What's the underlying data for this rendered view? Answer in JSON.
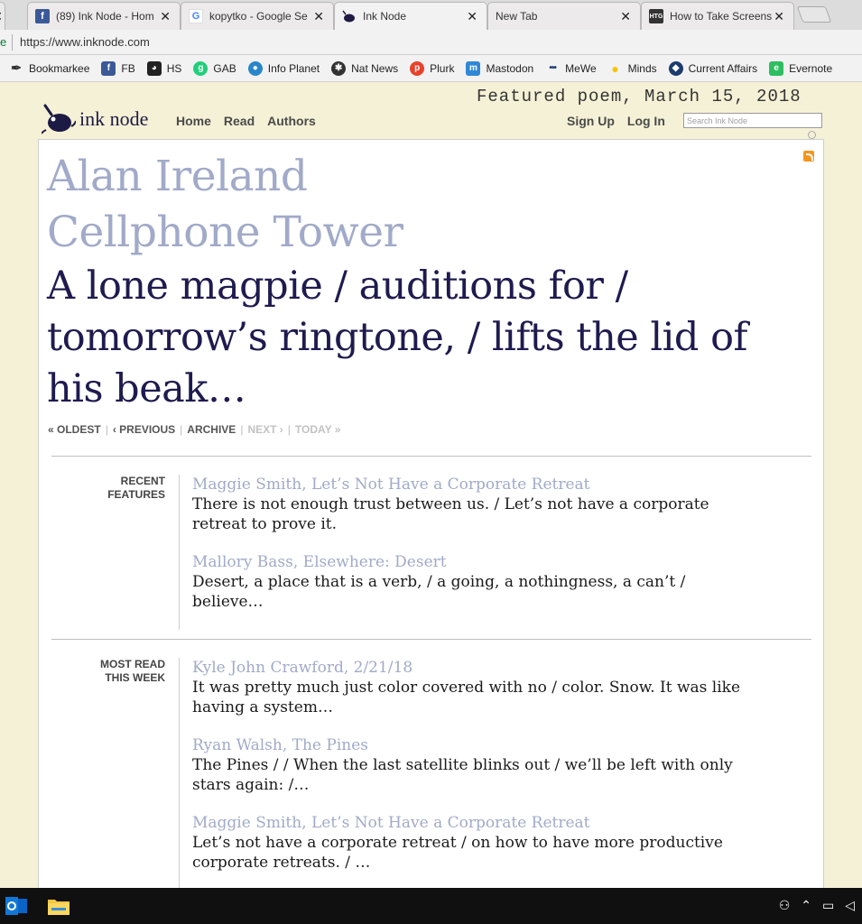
{
  "browser": {
    "tabs": [
      {
        "label": "(89) Ink Node - Hom",
        "icon": "facebook-icon",
        "active": false
      },
      {
        "label": "kopytko - Google Se",
        "icon": "google-icon",
        "active": false
      },
      {
        "label": "Ink Node",
        "icon": "inknode-icon",
        "active": true
      },
      {
        "label": "New Tab",
        "icon": "",
        "active": false
      },
      {
        "label": "How to Take Screens",
        "icon": "htg-icon",
        "active": false
      }
    ],
    "url": "https://www.inknode.com",
    "bookmarks": [
      {
        "label": "Bookmarkee",
        "icon": "bookmarkee-icon"
      },
      {
        "label": "FB",
        "icon": "facebook-icon"
      },
      {
        "label": "HS",
        "icon": "hootsuite-icon"
      },
      {
        "label": "GAB",
        "icon": "gab-icon"
      },
      {
        "label": "Info Planet",
        "icon": "infoplanet-icon"
      },
      {
        "label": "Nat News",
        "icon": "natnews-icon"
      },
      {
        "label": "Plurk",
        "icon": "plurk-icon"
      },
      {
        "label": "Mastodon",
        "icon": "mastodon-icon"
      },
      {
        "label": "MeWe",
        "icon": "mewe-icon"
      },
      {
        "label": "Minds",
        "icon": "minds-icon"
      },
      {
        "label": "Current Affairs",
        "icon": "currentaffairs-icon"
      },
      {
        "label": "Evernote",
        "icon": "evernote-icon"
      }
    ]
  },
  "site": {
    "featured_date": "Featured poem, March 15, 2018",
    "logo_text": "ink node",
    "nav": [
      "Home",
      "Read",
      "Authors"
    ],
    "account": [
      "Sign Up",
      "Log In"
    ],
    "search_placeholder": "Search Ink Node"
  },
  "featured": {
    "author": "Alan Ireland",
    "title": "Cellphone Tower",
    "excerpt": "A lone magpie / auditions for / tomorrow’s ringtone, / lifts the lid of his beak…"
  },
  "pager": {
    "oldest": "OLDEST",
    "previous": "PREVIOUS",
    "archive": "ARCHIVE",
    "next": "NEXT",
    "today": "TODAY"
  },
  "recent_features": {
    "label_line1": "RECENT",
    "label_line2": "FEATURES",
    "items": [
      {
        "title": "Maggie Smith, Let’s Not Have a Corporate Retreat",
        "text": "There is not enough trust between us. / Let’s not have a corporate retreat to prove it."
      },
      {
        "title": "Mallory Bass, Elsewhere: Desert",
        "text": "Desert, a place that is a verb, / a going, a nothingness, a can’t / believe…"
      }
    ]
  },
  "most_read": {
    "label_line1": "MOST READ",
    "label_line2": "THIS WEEK",
    "items": [
      {
        "title": "Kyle John Crawford, 2/21/18",
        "text": "It was pretty much just color covered with no / color. Snow. It was like having a system…"
      },
      {
        "title": "Ryan Walsh, The Pines",
        "text": "The Pines / / When the last satellite blinks out / we’ll be left with only stars again: /…"
      },
      {
        "title": "Maggie Smith, Let’s Not Have a Corporate Retreat",
        "text": "Let’s not have a corporate retreat / on how to have more productive corporate retreats. / …"
      }
    ]
  },
  "colors": {
    "page_bg": "#f5f1d6",
    "author_color": "#a1aac8",
    "excerpt_color": "#1f1b4f"
  }
}
